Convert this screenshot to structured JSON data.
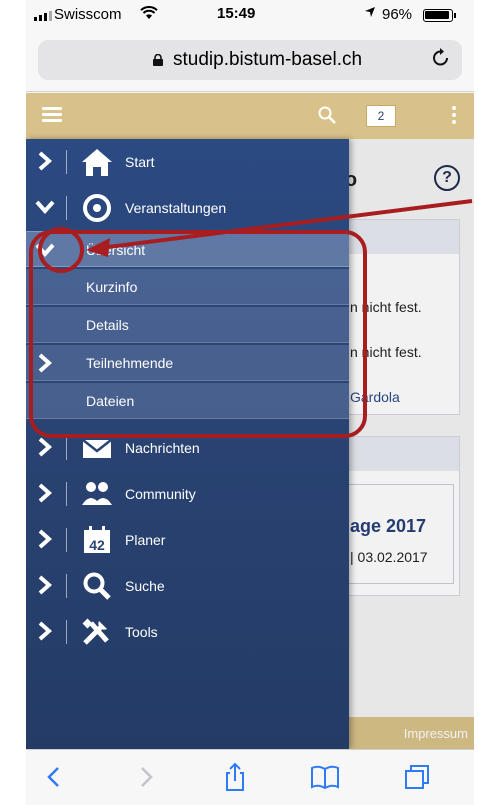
{
  "status": {
    "carrier": "Swisscom",
    "time": "15:49",
    "battery": "96%"
  },
  "browser": {
    "url": "studip.bistum-basel.ch"
  },
  "topbar": {
    "count": "2"
  },
  "content": {
    "title": "nfo",
    "line1": "n nicht fest.",
    "line2": "n nicht fest.",
    "line3": "Gardola",
    "line4": "age 2017",
    "line5": "| 03.02.2017",
    "footer": "Impressum"
  },
  "sidebar": {
    "items": [
      {
        "label": "Start",
        "icon": "home-icon"
      },
      {
        "label": "Veranstaltungen",
        "icon": "courses-icon"
      },
      {
        "label": "Übersicht",
        "icon": "chevron-down-icon"
      },
      {
        "label": "Kurzinfo"
      },
      {
        "label": "Details"
      },
      {
        "label": "Teilnehmende",
        "icon": "chevron-right-icon"
      },
      {
        "label": "Dateien"
      },
      {
        "label": "Nachrichten",
        "icon": "mail-icon"
      },
      {
        "label": "Community",
        "icon": "community-icon"
      },
      {
        "label": "Planer",
        "icon": "calendar-icon",
        "icon_text": "42"
      },
      {
        "label": "Suche",
        "icon": "search-icon"
      },
      {
        "label": "Tools",
        "icon": "tools-icon"
      }
    ]
  },
  "colors": {
    "sidebar": "#2a4474",
    "topbar": "#d9c28a",
    "annotation": "#a81d1f"
  }
}
